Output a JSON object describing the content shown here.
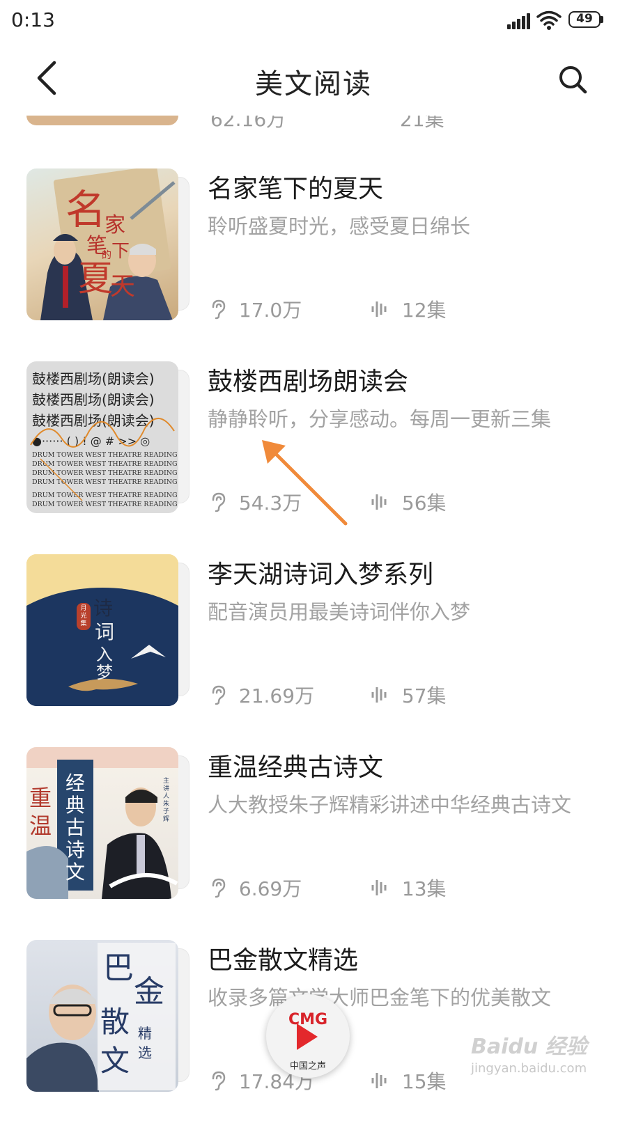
{
  "status_bar": {
    "time": "0:13",
    "battery": "49"
  },
  "header": {
    "title": "美文阅读"
  },
  "partial_item": {
    "plays": "62.16万",
    "episodes": "21集"
  },
  "items": [
    {
      "title": "名家笔下的夏天",
      "desc": "聆听盛夏时光，感受夏日绵长",
      "plays": "17.0万",
      "episodes": "12集",
      "cover_text": [
        "名",
        "家",
        "笔",
        "下",
        "的",
        "夏",
        "天"
      ]
    },
    {
      "title": "鼓楼西剧场朗读会",
      "desc": "静静聆听，分享感动。每周一更新三集",
      "plays": "54.3万",
      "episodes": "56集",
      "cover_text": [
        "鼓楼西剧场(朗读会)",
        "鼓楼西剧场(朗读会)",
        "鼓楼西剧场(朗读会)",
        "●······ ( ) ! @ # >> ◎",
        "DRUM TOWER WEST THEATRE READING"
      ]
    },
    {
      "title": "李天湖诗词入梦系列",
      "desc": "配音演员用最美诗词伴你入梦",
      "plays": "21.69万",
      "episodes": "57集",
      "cover_text": [
        "诗",
        "词",
        "入",
        "梦",
        "月光集"
      ]
    },
    {
      "title": "重温经典古诗文",
      "desc": "人大教授朱子辉精彩讲述中华经典古诗文",
      "plays": "6.69万",
      "episodes": "13集",
      "cover_text": [
        "重",
        "温",
        "经典古诗文",
        "主讲人 朱子辉"
      ]
    },
    {
      "title": "巴金散文精选",
      "desc": "收录多篇文学大师巴金笔下的优美散文",
      "plays": "17.84万",
      "episodes": "15集",
      "cover_text": [
        "巴",
        "金",
        "散",
        "文",
        "精",
        "选"
      ]
    }
  ],
  "player": {
    "logo": "CMG",
    "subtitle": "中国之声"
  },
  "watermark": {
    "brand": "Baidu 经验",
    "url": "jingyan.baidu.com"
  },
  "colors": {
    "accent": "#f08a3a",
    "title": "#1b1b1b",
    "desc": "#a2a2a2",
    "player_red": "#e3282c"
  }
}
